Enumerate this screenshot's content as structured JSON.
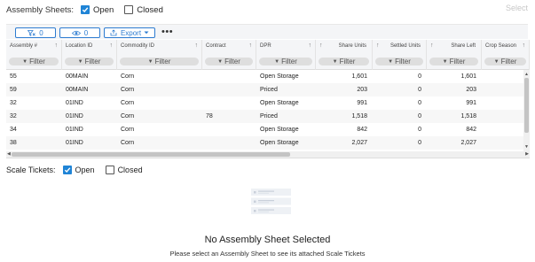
{
  "assembly_filter": {
    "label": "Assembly Sheets:",
    "open_label": "Open",
    "open_checked": true,
    "closed_label": "Closed",
    "closed_checked": false,
    "select_label": "Select"
  },
  "toolbar": {
    "clear_filter_count": "0",
    "visibility_count": "0",
    "export_label": "Export",
    "more_label": "•••",
    "accent_color": "#2e7cd1"
  },
  "grid": {
    "filter_label": "Filter",
    "columns": [
      {
        "key": "assembly",
        "label": "Assembly #"
      },
      {
        "key": "location",
        "label": "Location ID"
      },
      {
        "key": "commodity",
        "label": "Commodity ID"
      },
      {
        "key": "contract",
        "label": "Contract"
      },
      {
        "key": "dpr",
        "label": "DPR"
      },
      {
        "key": "share_units",
        "label": "Share Units"
      },
      {
        "key": "settled_units",
        "label": "Settled Units"
      },
      {
        "key": "share_left",
        "label": "Share Left"
      },
      {
        "key": "crop_season",
        "label": "Crop Season"
      }
    ],
    "rows": [
      {
        "assembly": "55",
        "location": "00MAIN",
        "commodity": "Corn",
        "contract": "",
        "dpr": "Open Storage",
        "share_units": "1,601",
        "settled_units": "0",
        "share_left": "1,601",
        "crop_season": ""
      },
      {
        "assembly": "59",
        "location": "00MAIN",
        "commodity": "Corn",
        "contract": "",
        "dpr": "Priced",
        "share_units": "203",
        "settled_units": "0",
        "share_left": "203",
        "crop_season": ""
      },
      {
        "assembly": "32",
        "location": "01IND",
        "commodity": "Corn",
        "contract": "",
        "dpr": "Open Storage",
        "share_units": "991",
        "settled_units": "0",
        "share_left": "991",
        "crop_season": ""
      },
      {
        "assembly": "32",
        "location": "01IND",
        "commodity": "Corn",
        "contract": "78",
        "dpr": "Priced",
        "share_units": "1,518",
        "settled_units": "0",
        "share_left": "1,518",
        "crop_season": ""
      },
      {
        "assembly": "34",
        "location": "01IND",
        "commodity": "Corn",
        "contract": "",
        "dpr": "Open Storage",
        "share_units": "842",
        "settled_units": "0",
        "share_left": "842",
        "crop_season": ""
      },
      {
        "assembly": "38",
        "location": "01IND",
        "commodity": "Corn",
        "contract": "",
        "dpr": "Open Storage",
        "share_units": "2,027",
        "settled_units": "0",
        "share_left": "2,027",
        "crop_season": ""
      }
    ]
  },
  "scale_filter": {
    "label": "Scale Tickets:",
    "open_label": "Open",
    "open_checked": true,
    "closed_label": "Closed",
    "closed_checked": false
  },
  "empty_state": {
    "title": "No Assembly Sheet Selected",
    "subtitle": "Please select an Assembly Sheet to see its attached Scale Tickets"
  }
}
